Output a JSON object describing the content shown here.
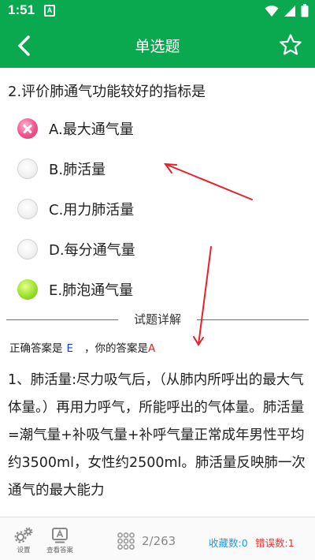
{
  "status_bar": {
    "time": "1:51",
    "notification_letter": "A",
    "icons": [
      "wifi-icon",
      "signal-icon",
      "battery-icon"
    ]
  },
  "app_bar": {
    "title": "单选题",
    "back_icon": "chevron-left-icon",
    "favorite_icon": "star-outline-icon"
  },
  "question": {
    "text": "2.评价肺通气功能较好的指标是"
  },
  "options": [
    {
      "label": "A.最大通气量",
      "state": "wrong"
    },
    {
      "label": "B.肺活量",
      "state": "empty"
    },
    {
      "label": "C.用力肺活量",
      "state": "empty"
    },
    {
      "label": "D.每分通气量",
      "state": "empty"
    },
    {
      "label": "E.肺泡通气量",
      "state": "correct"
    }
  ],
  "detail": {
    "title": "试题详解",
    "correct_prefix": "正确答案是",
    "correct_answer": "E",
    "your_prefix": "，你的答案是",
    "your_answer": "A",
    "explanation": "1、肺活量:尽力吸气后，（从肺内所呼出的最大气体量。）再用力呼气，所能呼出的气体量。肺活量=潮气量+补吸气量+补呼气量正常成年男性平均约3500ml，女性约2500ml。肺活量反映肺一次通气的最大能力"
  },
  "bottom_bar": {
    "settings_label": "设置",
    "view_answer_label": "查看答案",
    "progress": "2/263",
    "favorites": "收藏数:0",
    "errors": "错误数:1"
  },
  "colors": {
    "primary": "#0aa84f",
    "correct_answer": "#1a3fd6",
    "wrong_answer": "#e02525",
    "annotation_arrow": "#e8202a",
    "favorites": "#1e9be0"
  }
}
